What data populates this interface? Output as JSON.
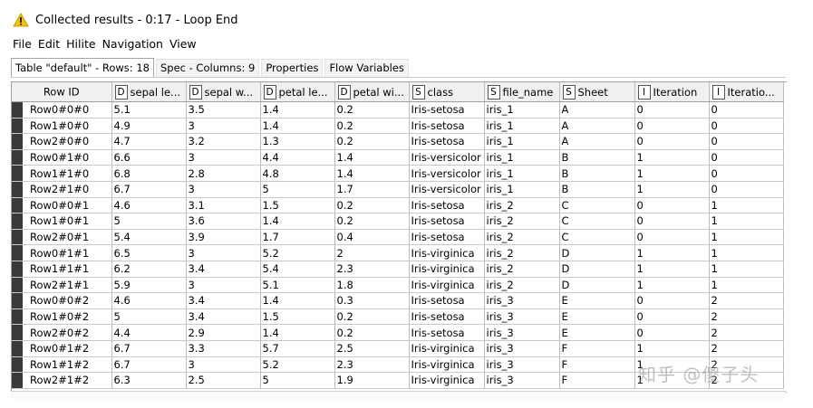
{
  "window": {
    "title": "Collected results - 0:17 - Loop End"
  },
  "menu": [
    "File",
    "Edit",
    "Hilite",
    "Navigation",
    "View"
  ],
  "tabs": [
    "Table \"default\" - Rows: 18",
    "Spec - Columns: 9",
    "Properties",
    "Flow Variables"
  ],
  "columns": [
    {
      "type": "",
      "label": "Row ID"
    },
    {
      "type": "D",
      "label": "sepal le..."
    },
    {
      "type": "D",
      "label": "sepal w..."
    },
    {
      "type": "D",
      "label": "petal le..."
    },
    {
      "type": "D",
      "label": "petal wi..."
    },
    {
      "type": "S",
      "label": "class"
    },
    {
      "type": "S",
      "label": "file_name"
    },
    {
      "type": "S",
      "label": "Sheet"
    },
    {
      "type": "I",
      "label": "Iteration"
    },
    {
      "type": "I",
      "label": "Iteratio..."
    }
  ],
  "rows": [
    [
      "Row0#0#0",
      "5.1",
      "3.5",
      "1.4",
      "0.2",
      "Iris-setosa",
      "iris_1",
      "A",
      "0",
      "0"
    ],
    [
      "Row1#0#0",
      "4.9",
      "3",
      "1.4",
      "0.2",
      "Iris-setosa",
      "iris_1",
      "A",
      "0",
      "0"
    ],
    [
      "Row2#0#0",
      "4.7",
      "3.2",
      "1.3",
      "0.2",
      "Iris-setosa",
      "iris_1",
      "A",
      "0",
      "0"
    ],
    [
      "Row0#1#0",
      "6.6",
      "3",
      "4.4",
      "1.4",
      "Iris-versicolor",
      "iris_1",
      "B",
      "1",
      "0"
    ],
    [
      "Row1#1#0",
      "6.8",
      "2.8",
      "4.8",
      "1.4",
      "Iris-versicolor",
      "iris_1",
      "B",
      "1",
      "0"
    ],
    [
      "Row2#1#0",
      "6.7",
      "3",
      "5",
      "1.7",
      "Iris-versicolor",
      "iris_1",
      "B",
      "1",
      "0"
    ],
    [
      "Row0#0#1",
      "4.6",
      "3.1",
      "1.5",
      "0.2",
      "Iris-setosa",
      "iris_2",
      "C",
      "0",
      "1"
    ],
    [
      "Row1#0#1",
      "5",
      "3.6",
      "1.4",
      "0.2",
      "Iris-setosa",
      "iris_2",
      "C",
      "0",
      "1"
    ],
    [
      "Row2#0#1",
      "5.4",
      "3.9",
      "1.7",
      "0.4",
      "Iris-setosa",
      "iris_2",
      "C",
      "0",
      "1"
    ],
    [
      "Row0#1#1",
      "6.5",
      "3",
      "5.2",
      "2",
      "Iris-virginica",
      "iris_2",
      "D",
      "1",
      "1"
    ],
    [
      "Row1#1#1",
      "6.2",
      "3.4",
      "5.4",
      "2.3",
      "Iris-virginica",
      "iris_2",
      "D",
      "1",
      "1"
    ],
    [
      "Row2#1#1",
      "5.9",
      "3",
      "5.1",
      "1.8",
      "Iris-virginica",
      "iris_2",
      "D",
      "1",
      "1"
    ],
    [
      "Row0#0#2",
      "4.6",
      "3.4",
      "1.4",
      "0.3",
      "Iris-setosa",
      "iris_3",
      "E",
      "0",
      "2"
    ],
    [
      "Row1#0#2",
      "5",
      "3.4",
      "1.5",
      "0.2",
      "Iris-setosa",
      "iris_3",
      "E",
      "0",
      "2"
    ],
    [
      "Row2#0#2",
      "4.4",
      "2.9",
      "1.4",
      "0.2",
      "Iris-setosa",
      "iris_3",
      "E",
      "0",
      "2"
    ],
    [
      "Row0#1#2",
      "6.7",
      "3.3",
      "5.7",
      "2.5",
      "Iris-virginica",
      "iris_3",
      "F",
      "1",
      "2"
    ],
    [
      "Row1#1#2",
      "6.7",
      "3",
      "5.2",
      "2.3",
      "Iris-virginica",
      "iris_3",
      "F",
      "1",
      "2"
    ],
    [
      "Row2#1#2",
      "6.3",
      "2.5",
      "5",
      "1.9",
      "Iris-virginica",
      "iris_3",
      "F",
      "1",
      "2"
    ]
  ],
  "watermark": "知乎 @傻子头",
  "colors": {
    "warning": "#f5c400",
    "header_bg": "#f0f0f0",
    "row_marker": "#3a3a3a"
  }
}
